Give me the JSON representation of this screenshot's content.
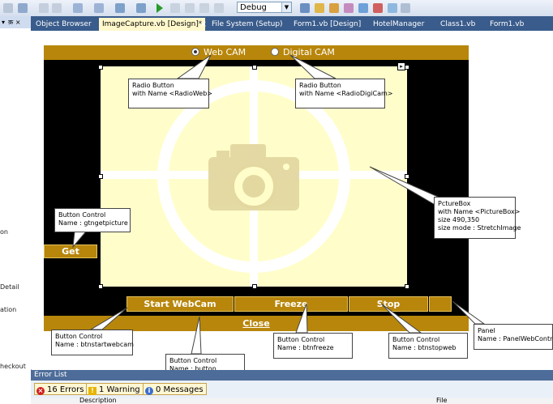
{
  "toolbar": {
    "config": "Debug"
  },
  "leftpanel": {
    "header": "▾  क़ ×",
    "fragments": [
      "on",
      "Detail",
      "ation",
      "heckout"
    ]
  },
  "tabs": [
    {
      "label": "Object Browser"
    },
    {
      "label": "ImageCapture.vb [Design]*",
      "close": "×"
    },
    {
      "label": "File System (Setup)"
    },
    {
      "label": "Form1.vb [Design]"
    },
    {
      "label": "HotelManager"
    },
    {
      "label": "Class1.vb"
    },
    {
      "label": "Form1.vb"
    }
  ],
  "form": {
    "radio_web": "Web CAM",
    "radio_digital": "Digital CAM",
    "get_button": "Get",
    "start_button": "Start WebCam",
    "freeze_button": "Freeze",
    "stop_button": "Stop",
    "close_button": "Close",
    "smart_tag": "▸"
  },
  "callouts": {
    "radioweb": [
      "Radio Button",
      "with Name <RadioWeb>"
    ],
    "radiodigi": [
      "Radio Button",
      "with Name <RadioDigiCam>"
    ],
    "picturebox": [
      "PctureBox",
      "with Name <PictureBox>",
      "size 490,350",
      "size mode : StretchImage"
    ],
    "getbtn": [
      "Button Control",
      "Name : gtngetpicture"
    ],
    "startbtn": [
      "Button Control",
      "Name : btnstartwebcam"
    ],
    "closebtn": [
      "Button Control",
      "Name : button"
    ],
    "freezebtn": [
      "Button Control",
      "Name : btnfreeze"
    ],
    "stopbtn": [
      "Button Control",
      "Name : btnstopweb"
    ],
    "panel": [
      "Panel",
      "Name : PanelWebControls"
    ]
  },
  "errorlist": {
    "title": "Error List",
    "errors": "16 Errors",
    "warnings": "1 Warning",
    "messages": "0 Messages",
    "columns": [
      "Description",
      "File"
    ]
  },
  "colors": {
    "accent": "#b8860b",
    "picture_bg": "#fffecb",
    "tab_strip": "#3a5c8c"
  }
}
